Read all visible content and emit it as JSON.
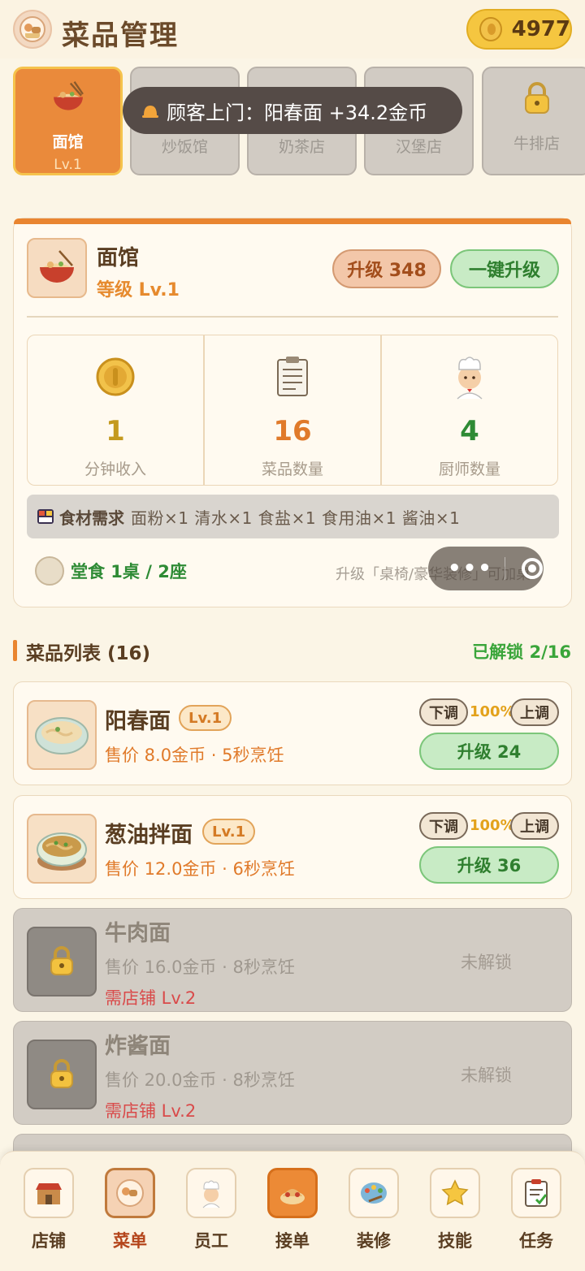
{
  "header": {
    "title": "菜品管理",
    "coins": "4977"
  },
  "shop_tabs": [
    {
      "label": "面馆",
      "level": "Lv.1",
      "active": true,
      "locked": false
    },
    {
      "label": "炒饭馆",
      "locked": false
    },
    {
      "label": "奶茶店",
      "locked": false
    },
    {
      "label": "汉堡店",
      "locked": false
    },
    {
      "label": "牛排店",
      "locked": true
    }
  ],
  "toast": {
    "text": "顾客上门：阳春面 +34.2金币"
  },
  "shop": {
    "name": "面馆",
    "level": "等级 Lv.1",
    "upgrade_label": "升级 348",
    "oneclick_label": "一键升级",
    "stats": [
      {
        "value": "1",
        "label": "分钟收入",
        "color": "#c49a1f"
      },
      {
        "value": "16",
        "label": "菜品数量",
        "color": "#e07a2a"
      },
      {
        "value": "4",
        "label": "厨师数量",
        "color": "#2e8b35"
      }
    ],
    "ingredients_title": "食材需求",
    "ingredients": "面粉×1  清水×1  食盐×1  食用油×1  酱油×1",
    "dine_text": "堂食 1桌 / 2座",
    "dine_hint": "升级「桌椅/豪华装修」可加桌"
  },
  "dish_list": {
    "title": "菜品列表 (16)",
    "unlocked": "已解锁 2/16",
    "dishes": [
      {
        "name": "阳春面",
        "level": "Lv.1",
        "price": "售价 8.0金币 · 5秒烹饪",
        "down": "下调",
        "pct": "100%",
        "up": "上调",
        "upgrade": "升级 24",
        "locked": false
      },
      {
        "name": "葱油拌面",
        "level": "Lv.1",
        "price": "售价 12.0金币 · 6秒烹饪",
        "down": "下调",
        "pct": "100%",
        "up": "上调",
        "upgrade": "升级 36",
        "locked": false
      },
      {
        "name": "牛肉面",
        "price": "售价 16.0金币 · 8秒烹饪",
        "requirement": "需店铺 Lv.2",
        "status": "未解锁",
        "locked": true
      },
      {
        "name": "炸酱面",
        "price": "售价 20.0金币 · 8秒烹饪",
        "requirement": "需店铺 Lv.2",
        "status": "未解锁",
        "locked": true
      }
    ]
  },
  "nav": [
    {
      "label": "店铺",
      "icon": "shop-icon"
    },
    {
      "label": "菜单",
      "icon": "menu-icon",
      "active": true
    },
    {
      "label": "员工",
      "icon": "chef-icon"
    },
    {
      "label": "接单",
      "icon": "orders-icon"
    },
    {
      "label": "装修",
      "icon": "palette-icon"
    },
    {
      "label": "技能",
      "icon": "star-icon"
    },
    {
      "label": "任务",
      "icon": "clipboard-icon"
    }
  ],
  "colors": {
    "accent": "#e98530",
    "green": "#2e8b35",
    "gold": "#f5c640"
  }
}
